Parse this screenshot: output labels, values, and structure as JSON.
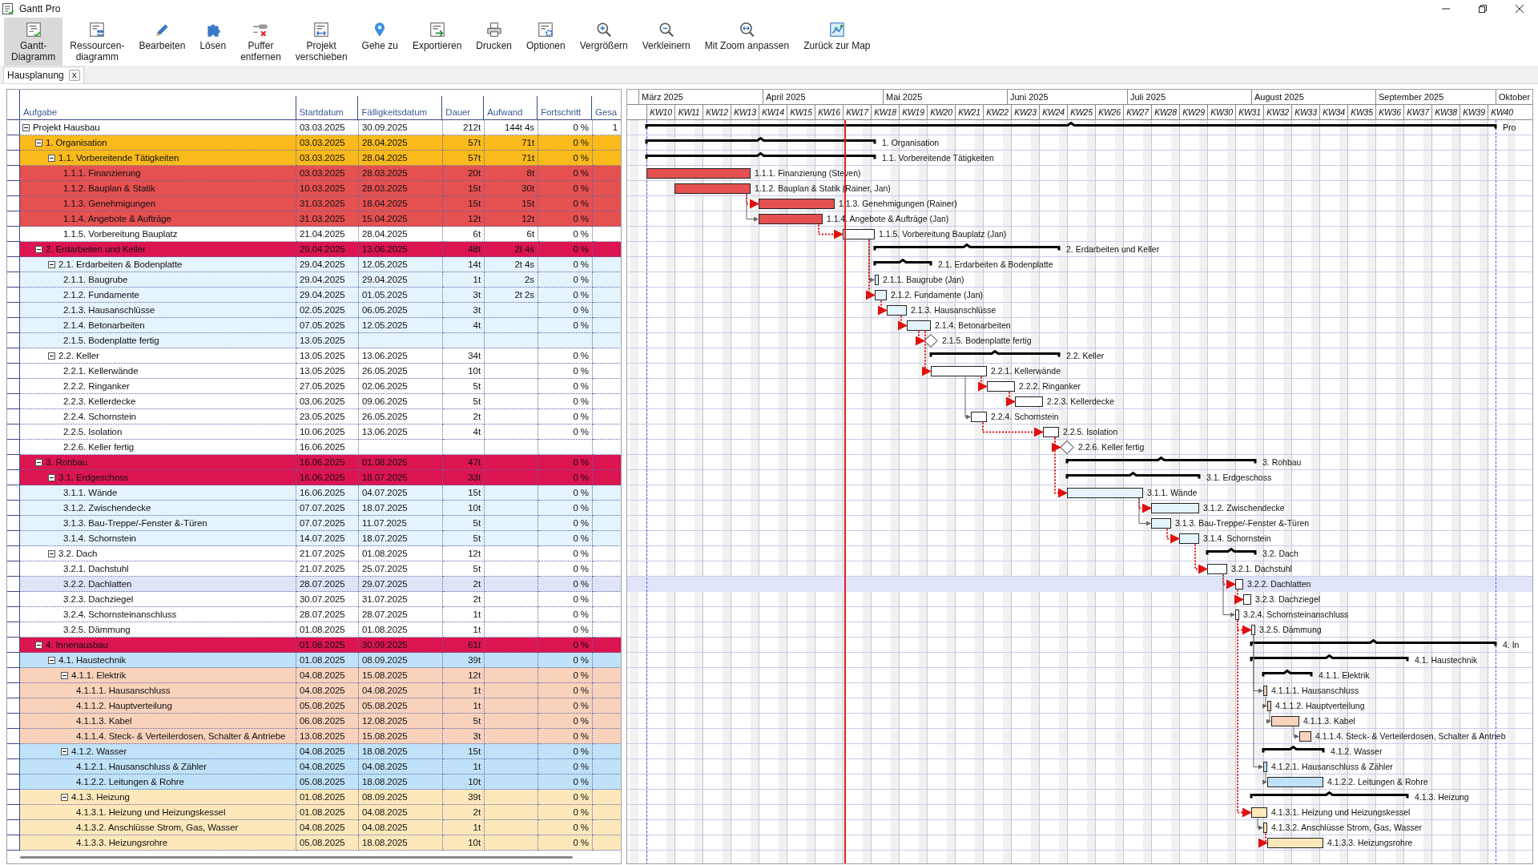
{
  "window": {
    "title": "Gantt Pro"
  },
  "toolbar": [
    {
      "label": "Gantt-\nDiagramm",
      "selected": true
    },
    {
      "label": "Ressourcen-\ndiagramm",
      "selected": false
    },
    {
      "label": "Bearbeiten",
      "selected": false
    },
    {
      "label": "Lösen",
      "selected": false
    },
    {
      "label": "Puffer\nentfernen",
      "selected": false
    },
    {
      "label": "Projekt\nverschieben",
      "selected": false
    },
    {
      "label": "Gehe zu",
      "selected": false
    },
    {
      "label": "Exportieren",
      "selected": false
    },
    {
      "label": "Drucken",
      "selected": false
    },
    {
      "label": "Optionen",
      "selected": false
    },
    {
      "label": "Vergrößern",
      "selected": false
    },
    {
      "label": "Verkleinern",
      "selected": false
    },
    {
      "label": "Mit Zoom anpassen",
      "selected": false
    },
    {
      "label": "Zurück zur Map",
      "selected": false
    }
  ],
  "document_tabs": [
    {
      "label": "Hausplanung",
      "close": "X",
      "selected": true
    }
  ],
  "table": {
    "columns": [
      "Aufgabe",
      "Startdatum",
      "Fälligkeitsdatum",
      "Dauer",
      "Aufwand",
      "Fortschritt",
      "Gesa"
    ],
    "rows": [
      {
        "task": "Projekt Hausbau",
        "start": "03.03.2025",
        "end": "30.09.2025",
        "duration": "212t",
        "effort": "144t 4s",
        "progress": "0 %",
        "column_7": "1",
        "kind": "summary",
        "color": "#ffffff",
        "selected": false,
        "expanded": true,
        "chart_label": "Pro",
        "children": [
          {
            "task": "1. Organisation",
            "start": "03.03.2025",
            "end": "28.04.2025",
            "duration": "57t",
            "effort": "71t",
            "progress": "0 %",
            "kind": "summary",
            "color": "#fbba1c",
            "selected": false,
            "expanded": true,
            "chart_label": "1. Organisation",
            "children": [
              {
                "task": "1.1. Vorbereitende Tätigkeiten",
                "start": "03.03.2025",
                "end": "28.04.2025",
                "duration": "57t",
                "effort": "71t",
                "progress": "0 %",
                "kind": "summary",
                "color": "#fbba1c",
                "selected": false,
                "expanded": true,
                "chart_label": "1.1. Vorbereitende Tätigkeiten",
                "children": [
                  {
                    "task": "1.1.1. Finanzierung",
                    "start": "03.03.2025",
                    "end": "28.03.2025",
                    "duration": "20t",
                    "effort": "8t",
                    "progress": "0 %",
                    "kind": "task",
                    "color": "#e55050",
                    "selected": false,
                    "chart_label": "1.1.1. Finanzierung (Steven)"
                  },
                  {
                    "task": "1.1.2. Bauplan & Statik",
                    "start": "10.03.2025",
                    "end": "28.03.2025",
                    "duration": "15t",
                    "effort": "30t",
                    "progress": "0 %",
                    "kind": "task",
                    "color": "#e55050",
                    "selected": false,
                    "chart_label": "1.1.2. Bauplan & Statik (Rainer, Jan)"
                  },
                  {
                    "task": "1.1.3. Genehmigungen",
                    "start": "31.03.2025",
                    "end": "18.04.2025",
                    "duration": "15t",
                    "effort": "15t",
                    "progress": "0 %",
                    "kind": "task",
                    "color": "#e55050",
                    "selected": false,
                    "chart_label": "1.1.3. Genehmigungen (Rainer)",
                    "link_critical": true
                  },
                  {
                    "task": "1.1.4. Angebote & Aufträge",
                    "start": "31.03.2025",
                    "end": "15.04.2025",
                    "duration": "12t",
                    "effort": "12t",
                    "progress": "0 %",
                    "kind": "task",
                    "color": "#e55050",
                    "selected": false,
                    "chart_label": "1.1.4. Angebote & Aufträge (Jan)",
                    "link_critical": false
                  },
                  {
                    "task": "1.1.5. Vorbereitung Bauplatz",
                    "start": "21.04.2025",
                    "end": "28.04.2025",
                    "duration": "6t",
                    "effort": "6t",
                    "progress": "0 %",
                    "kind": "task",
                    "color": "#ffffff",
                    "selected": false,
                    "chart_label": "1.1.5. Vorbereitung Bauplatz (Jan)",
                    "link_critical": true
                  }
                ]
              }
            ]
          },
          {
            "task": "2. Erdarbeiten und Keller",
            "start": "29.04.2025",
            "end": "13.06.2025",
            "duration": "48t",
            "effort": "2t 4s",
            "progress": "0 %",
            "kind": "summary",
            "color": "#dc1450",
            "selected": false,
            "expanded": true,
            "chart_label": "2. Erdarbeiten und Keller",
            "children": [
              {
                "task": "2.1. Erdarbeiten & Bodenplatte",
                "start": "29.04.2025",
                "end": "12.05.2025",
                "duration": "14t",
                "effort": "2t 4s",
                "progress": "0 %",
                "kind": "summary",
                "color": "#e5f3fd",
                "selected": false,
                "expanded": true,
                "chart_label": "2.1. Erdarbeiten & Bodenplatte",
                "children": [
                  {
                    "task": "2.1.1. Baugrube",
                    "start": "29.04.2025",
                    "end": "29.04.2025",
                    "duration": "1t",
                    "effort": "2s",
                    "progress": "0 %",
                    "kind": "task",
                    "color": "#e5f3fd",
                    "selected": false,
                    "chart_label": "2.1.1. Baugrube (Jan)",
                    "link_critical": false
                  },
                  {
                    "task": "2.1.2. Fundamente",
                    "start": "29.04.2025",
                    "end": "01.05.2025",
                    "duration": "3t",
                    "effort": "2t 2s",
                    "progress": "0 %",
                    "kind": "task",
                    "color": "#e5f3fd",
                    "selected": false,
                    "chart_label": "2.1.2. Fundamente (Jan)",
                    "link_critical": true
                  },
                  {
                    "task": "2.1.3. Hausanschlüsse",
                    "start": "02.05.2025",
                    "end": "06.05.2025",
                    "duration": "3t",
                    "progress": "0 %",
                    "kind": "task",
                    "color": "#e5f3fd",
                    "selected": false,
                    "chart_label": "2.1.3. Hausanschlüsse",
                    "link_critical": true
                  },
                  {
                    "task": "2.1.4. Betonarbeiten",
                    "start": "07.05.2025",
                    "end": "12.05.2025",
                    "duration": "4t",
                    "progress": "0 %",
                    "kind": "task",
                    "color": "#e5f3fd",
                    "selected": false,
                    "chart_label": "2.1.4. Betonarbeiten",
                    "link_critical": true
                  },
                  {
                    "task": "2.1.5. Bodenplatte fertig",
                    "start": "13.05.2025",
                    "kind": "milestone",
                    "color": "#e5f3fd",
                    "selected": false,
                    "chart_label": "2.1.5. Bodenplatte fertig",
                    "link_critical": true
                  }
                ]
              },
              {
                "task": "2.2. Keller",
                "start": "13.05.2025",
                "end": "13.06.2025",
                "duration": "34t",
                "progress": "0 %",
                "kind": "summary",
                "color": "#ffffff",
                "selected": false,
                "expanded": true,
                "chart_label": "2.2. Keller",
                "children": [
                  {
                    "task": "2.2.1. Kellerwände",
                    "start": "13.05.2025",
                    "end": "26.05.2025",
                    "duration": "10t",
                    "progress": "0 %",
                    "kind": "task",
                    "color": "#ffffff",
                    "selected": false,
                    "chart_label": "2.2.1. Kellerwände",
                    "link_critical": true
                  },
                  {
                    "task": "2.2.2. Ringanker",
                    "start": "27.05.2025",
                    "end": "02.06.2025",
                    "duration": "5t",
                    "progress": "0 %",
                    "kind": "task",
                    "color": "#ffffff",
                    "selected": false,
                    "chart_label": "2.2.2. Ringanker",
                    "link_critical": true
                  },
                  {
                    "task": "2.2.3. Kellerdecke",
                    "start": "03.06.2025",
                    "end": "09.06.2025",
                    "duration": "5t",
                    "progress": "0 %",
                    "kind": "task",
                    "color": "#ffffff",
                    "selected": false,
                    "chart_label": "2.2.3. Kellerdecke",
                    "link_critical": true
                  },
                  {
                    "task": "2.2.4. Schornstein",
                    "start": "23.05.2025",
                    "end": "26.05.2025",
                    "duration": "2t",
                    "progress": "0 %",
                    "kind": "task",
                    "color": "#ffffff",
                    "selected": false,
                    "chart_label": "2.2.4. Schornstein",
                    "link_critical": false
                  },
                  {
                    "task": "2.2.5. Isolation",
                    "start": "10.06.2025",
                    "end": "13.06.2025",
                    "duration": "4t",
                    "progress": "0 %",
                    "kind": "task",
                    "color": "#ffffff",
                    "selected": false,
                    "chart_label": "2.2.5. Isolation",
                    "link_critical": true
                  },
                  {
                    "task": "2.2.6. Keller fertig",
                    "start": "16.06.2025",
                    "kind": "milestone",
                    "color": "#ffffff",
                    "selected": false,
                    "chart_label": "2.2.6. Keller fertig",
                    "link_critical": true
                  }
                ]
              }
            ]
          },
          {
            "task": "3. Rohbau",
            "start": "16.06.2025",
            "end": "01.08.2025",
            "duration": "47t",
            "progress": "0 %",
            "kind": "summary",
            "color": "#dc1450",
            "selected": false,
            "expanded": true,
            "chart_label": "3. Rohbau",
            "children": [
              {
                "task": "3.1. Erdgeschoss",
                "start": "16.06.2025",
                "end": "18.07.2025",
                "duration": "33t",
                "progress": "0 %",
                "kind": "summary",
                "color": "#dc1450",
                "selected": false,
                "expanded": true,
                "chart_label": "3.1. Erdgeschoss",
                "children": [
                  {
                    "task": "3.1.1. Wände",
                    "start": "16.06.2025",
                    "end": "04.07.2025",
                    "duration": "15t",
                    "progress": "0 %",
                    "kind": "task",
                    "color": "#e5f3fd",
                    "selected": false,
                    "chart_label": "3.1.1. Wände",
                    "link_critical": true
                  },
                  {
                    "task": "3.1.2. Zwischendecke",
                    "start": "07.07.2025",
                    "end": "18.07.2025",
                    "duration": "10t",
                    "progress": "0 %",
                    "kind": "task",
                    "color": "#e5f3fd",
                    "selected": false,
                    "chart_label": "3.1.2. Zwischendecke",
                    "link_critical": true
                  },
                  {
                    "task": "3.1.3. Bau-Treppe/-Fenster &-Türen",
                    "start": "07.07.2025",
                    "end": "11.07.2025",
                    "duration": "5t",
                    "progress": "0 %",
                    "kind": "task",
                    "color": "#e5f3fd",
                    "selected": false,
                    "chart_label": "3.1.3. Bau-Treppe/-Fenster &-Türen",
                    "link_critical": false
                  },
                  {
                    "task": "3.1.4. Schornstein",
                    "start": "14.07.2025",
                    "end": "18.07.2025",
                    "duration": "5t",
                    "progress": "0 %",
                    "kind": "task",
                    "color": "#e5f3fd",
                    "selected": false,
                    "chart_label": "3.1.4. Schornstein",
                    "link_critical": true
                  }
                ]
              },
              {
                "task": "3.2. Dach",
                "start": "21.07.2025",
                "end": "01.08.2025",
                "duration": "12t",
                "progress": "0 %",
                "kind": "summary",
                "color": "#ffffff",
                "selected": false,
                "expanded": true,
                "chart_label": "3.2. Dach",
                "children": [
                  {
                    "task": "3.2.1. Dachstuhl",
                    "start": "21.07.2025",
                    "end": "25.07.2025",
                    "duration": "5t",
                    "progress": "0 %",
                    "kind": "task",
                    "color": "#ffffff",
                    "selected": false,
                    "chart_label": "3.2.1. Dachstuhl",
                    "link_critical": true
                  },
                  {
                    "task": "3.2.2. Dachlatten",
                    "start": "28.07.2025",
                    "end": "29.07.2025",
                    "duration": "2t",
                    "progress": "0 %",
                    "kind": "task",
                    "color": "#ffffff",
                    "selected": true,
                    "chart_label": "3.2.2. Dachlatten",
                    "link_critical": true
                  },
                  {
                    "task": "3.2.3. Dachziegel",
                    "start": "30.07.2025",
                    "end": "31.07.2025",
                    "duration": "2t",
                    "progress": "0 %",
                    "kind": "task",
                    "color": "#ffffff",
                    "selected": false,
                    "chart_label": "3.2.3. Dachziegel",
                    "link_critical": true
                  },
                  {
                    "task": "3.2.4. Schornsteinanschluss",
                    "start": "28.07.2025",
                    "end": "28.07.2025",
                    "duration": "1t",
                    "progress": "0 %",
                    "kind": "task",
                    "color": "#ffffff",
                    "selected": false,
                    "chart_label": "3.2.4. Schornsteinanschluss",
                    "link_critical": false
                  },
                  {
                    "task": "3.2.5. Dämmung",
                    "start": "01.08.2025",
                    "end": "01.08.2025",
                    "duration": "1t",
                    "progress": "0 %",
                    "kind": "task",
                    "color": "#ffffff",
                    "selected": false,
                    "chart_label": "3.2.5. Dämmung",
                    "link_critical": true
                  }
                ]
              }
            ]
          },
          {
            "task": "4. Innenausbau",
            "start": "01.08.2025",
            "end": "30.09.2025",
            "duration": "61t",
            "progress": "0 %",
            "kind": "summary",
            "color": "#dc1450",
            "selected": false,
            "expanded": true,
            "chart_label": "4. In",
            "children": [
              {
                "task": "4.1. Haustechnik",
                "start": "01.08.2025",
                "end": "08.09.2025",
                "duration": "39t",
                "progress": "0 %",
                "kind": "summary",
                "color": "#c0e2f8",
                "selected": false,
                "expanded": true,
                "chart_label": "4.1. Haustechnik",
                "children": [
                  {
                    "task": "4.1.1. Elektrik",
                    "start": "04.08.2025",
                    "end": "15.08.2025",
                    "duration": "12t",
                    "progress": "0 %",
                    "kind": "summary",
                    "color": "#f9d2bc",
                    "selected": false,
                    "expanded": true,
                    "chart_label": "4.1.1. Elektrik",
                    "children": [
                      {
                        "task": "4.1.1.1. Hausanschluss",
                        "start": "04.08.2025",
                        "end": "04.08.2025",
                        "duration": "1t",
                        "progress": "0 %",
                        "kind": "task",
                        "color": "#f9d2bc",
                        "selected": false,
                        "chart_label": "4.1.1.1. Hausanschluss",
                        "link_critical": false
                      },
                      {
                        "task": "4.1.1.2. Hauptverteilung",
                        "start": "05.08.2025",
                        "end": "05.08.2025",
                        "duration": "1t",
                        "progress": "0 %",
                        "kind": "task",
                        "color": "#f9d2bc",
                        "selected": false,
                        "chart_label": "4.1.1.2. Hauptverteilung",
                        "link_critical": false
                      },
                      {
                        "task": "4.1.1.3. Kabel",
                        "start": "06.08.2025",
                        "end": "12.08.2025",
                        "duration": "5t",
                        "progress": "0 %",
                        "kind": "task",
                        "color": "#f9d2bc",
                        "selected": false,
                        "chart_label": "4.1.1.3. Kabel",
                        "link_critical": false
                      },
                      {
                        "task": "4.1.1.4. Steck- & Verteilerdosen, Schalter & Antriebe",
                        "start": "13.08.2025",
                        "end": "15.08.2025",
                        "duration": "3t",
                        "progress": "0 %",
                        "kind": "task",
                        "color": "#f9d2bc",
                        "selected": false,
                        "chart_label": "4.1.1.4. Steck- & Verteilerdosen, Schalter & Antrieb",
                        "link_critical": false
                      }
                    ]
                  },
                  {
                    "task": "4.1.2. Wasser",
                    "start": "04.08.2025",
                    "end": "18.08.2025",
                    "duration": "15t",
                    "progress": "0 %",
                    "kind": "summary",
                    "color": "#c0e2f8",
                    "selected": false,
                    "expanded": true,
                    "chart_label": "4.1.2. Wasser",
                    "children": [
                      {
                        "task": "4.1.2.1. Hausanschluss & Zähler",
                        "start": "04.08.2025",
                        "end": "04.08.2025",
                        "duration": "1t",
                        "progress": "0 %",
                        "kind": "task",
                        "color": "#c0e2f8",
                        "selected": false,
                        "chart_label": "4.1.2.1. Hausanschluss & Zähler",
                        "link_critical": false
                      },
                      {
                        "task": "4.1.2.2. Leitungen & Rohre",
                        "start": "05.08.2025",
                        "end": "18.08.2025",
                        "duration": "10t",
                        "progress": "0 %",
                        "kind": "task",
                        "color": "#c0e2f8",
                        "selected": false,
                        "chart_label": "4.1.2.2. Leitungen & Rohre",
                        "link_critical": false
                      }
                    ]
                  },
                  {
                    "task": "4.1.3. Heizung",
                    "start": "01.08.2025",
                    "end": "08.09.2025",
                    "duration": "39t",
                    "progress": "0 %",
                    "kind": "summary",
                    "color": "#fde8bb",
                    "selected": false,
                    "expanded": true,
                    "chart_label": "4.1.3. Heizung",
                    "children": [
                      {
                        "task": "4.1.3.1. Heizung und Heizungskessel",
                        "start": "01.08.2025",
                        "end": "04.08.2025",
                        "duration": "2t",
                        "progress": "0 %",
                        "kind": "task",
                        "color": "#fde8bb",
                        "selected": false,
                        "chart_label": "4.1.3.1. Heizung und Heizungskessel",
                        "link_critical": true
                      },
                      {
                        "task": "4.1.3.2. Anschlüsse Strom, Gas, Wasser",
                        "start": "04.08.2025",
                        "end": "04.08.2025",
                        "duration": "1t",
                        "progress": "0 %",
                        "kind": "task",
                        "color": "#fde8bb",
                        "selected": false,
                        "chart_label": "4.1.3.2. Anschlüsse Strom, Gas, Wasser",
                        "link_critical": false
                      },
                      {
                        "task": "4.1.3.3. Heizungsrohre",
                        "start": "05.08.2025",
                        "end": "18.08.2025",
                        "duration": "10t",
                        "progress": "0 %",
                        "kind": "task",
                        "color": "#fde8bb",
                        "selected": false,
                        "chart_label": "4.1.3.3. Heizungsrohre",
                        "link_critical": true
                      }
                    ]
                  }
                ]
              }
            ]
          }
        ]
      }
    ]
  },
  "timeline": {
    "months": [
      "März 2025",
      "April 2025",
      "Mai 2025",
      "Juni 2025",
      "Juli 2025",
      "August 2025",
      "September 2025",
      "Oktober"
    ],
    "weeks": [
      "KW10",
      "KW11",
      "KW12",
      "KW13",
      "KW14",
      "KW15",
      "KW16",
      "KW17",
      "KW18",
      "KW19",
      "KW20",
      "KW21",
      "KW22",
      "KW23",
      "KW24",
      "KW25",
      "KW26",
      "KW27",
      "KW28",
      "KW29",
      "KW30",
      "KW31",
      "KW32",
      "KW33",
      "KW34",
      "KW35",
      "KW36",
      "KW37",
      "KW38",
      "KW39",
      "KW40"
    ],
    "today_line": {
      "level": 0.24
    }
  }
}
